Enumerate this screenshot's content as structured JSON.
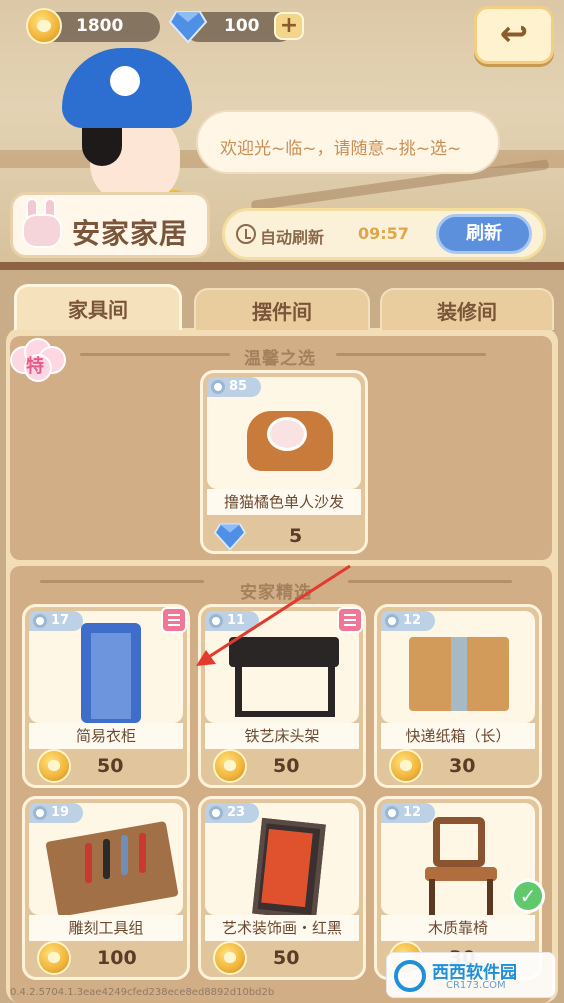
{
  "header": {
    "coins": "1800",
    "diamonds": "100",
    "plus_label": "+",
    "back_label": "↩"
  },
  "npc": {
    "greeting": "欢迎光~临~，请随意~挑~选~"
  },
  "store": {
    "name": "安家家居",
    "auto_refresh_label": "自动刷新",
    "timer": "09:57",
    "refresh_button": "刷新"
  },
  "tabs": [
    {
      "label": "家具间",
      "active": true
    },
    {
      "label": "摆件间",
      "active": false
    },
    {
      "label": "装修间",
      "active": false
    }
  ],
  "featured": {
    "section_title": "温馨之选",
    "special_badge": "特",
    "item": {
      "level": "85",
      "name": "撸猫橘色单人沙发",
      "price": "5",
      "currency": "diamond"
    }
  },
  "selection": {
    "section_title": "安家精选",
    "items": [
      {
        "level": "17",
        "name": "简易衣柜",
        "price": "50",
        "currency": "coin",
        "book": true
      },
      {
        "level": "11",
        "name": "铁艺床头架",
        "price": "50",
        "currency": "coin",
        "book": true
      },
      {
        "level": "12",
        "name": "快递纸箱（长）",
        "price": "30",
        "currency": "coin",
        "book": false
      },
      {
        "level": "19",
        "name": "雕刻工具组",
        "price": "100",
        "currency": "coin",
        "book": false
      },
      {
        "level": "23",
        "name": "艺术装饰画・红黑",
        "price": "50",
        "currency": "coin",
        "book": false
      },
      {
        "level": "12",
        "name": "木质靠椅",
        "price": "30",
        "currency": "coin",
        "owned": true
      }
    ]
  },
  "footer": {
    "version": "0.4.2.5704.1.3eae4249cfed238ece8ed8892d10bd2b"
  },
  "watermark": {
    "brand": "西西软件园",
    "site": "CR173.COM"
  },
  "colors": {
    "accent_blue": "#5c8fdc",
    "timer_orange": "#e0a64b",
    "special_pink": "#e45a8a",
    "owned_green": "#5fc96c"
  }
}
